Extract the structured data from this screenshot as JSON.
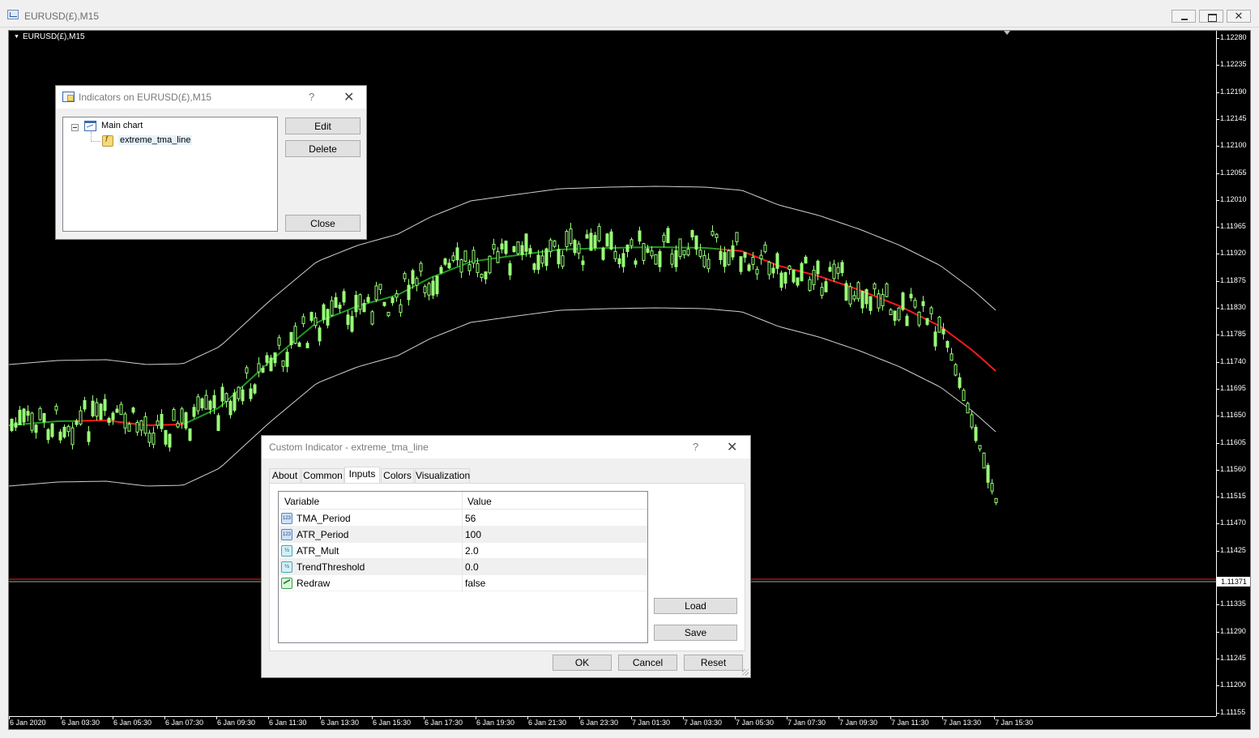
{
  "window": {
    "title": "EURUSD(£),M15"
  },
  "chart": {
    "label": "EURUSD(£),M15",
    "current_price": "1.11371",
    "price_labels": [
      "1.12280",
      "1.12235",
      "1.12190",
      "1.12145",
      "1.12100",
      "1.12055",
      "1.12010",
      "1.11965",
      "1.11920",
      "1.11875",
      "1.11830",
      "1.11785",
      "1.11740",
      "1.11695",
      "1.11650",
      "1.11605",
      "1.11560",
      "1.11515",
      "1.11470",
      "1.11425",
      "1.11335",
      "1.11290",
      "1.11245",
      "1.11200",
      "1.11155"
    ],
    "time_labels": [
      "6 Jan 2020",
      "6 Jan 03:30",
      "6 Jan 05:30",
      "6 Jan 07:30",
      "6 Jan 09:30",
      "6 Jan 11:30",
      "6 Jan 13:30",
      "6 Jan 15:30",
      "6 Jan 17:30",
      "6 Jan 19:30",
      "6 Jan 21:30",
      "6 Jan 23:30",
      "7 Jan 01:30",
      "7 Jan 03:30",
      "7 Jan 05:30",
      "7 Jan 07:30",
      "7 Jan 09:30",
      "7 Jan 11:30",
      "7 Jan 13:30",
      "7 Jan 15:30"
    ],
    "colors": {
      "background": "#000000",
      "candle": "#99ff77",
      "tma_up": "#1f9a1f",
      "tma_down": "#ff1a1a",
      "band": "#d0d0d0",
      "price_line": "#ff2020"
    }
  },
  "indicators_dialog": {
    "title": "Indicators on EURUSD(£),M15",
    "help": "?",
    "close_glyph": "✕",
    "tree_root": "Main chart",
    "tree_child": "extreme_tma_line",
    "edit_label": "Edit",
    "delete_label": "Delete",
    "close_label": "Close"
  },
  "custom_indicator_dialog": {
    "title": "Custom Indicator - extreme_tma_line",
    "help": "?",
    "close_glyph": "✕",
    "tabs": [
      "About",
      "Common",
      "Inputs",
      "Colors",
      "Visualization"
    ],
    "active_tab": "Inputs",
    "columns": {
      "variable": "Variable",
      "value": "Value"
    },
    "rows": [
      {
        "variable": "TMA_Period",
        "value": "56",
        "type_icon": "123"
      },
      {
        "variable": "ATR_Period",
        "value": "100",
        "type_icon": "123"
      },
      {
        "variable": "ATR_Mult",
        "value": "2.0",
        "type_icon": "½"
      },
      {
        "variable": "TrendThreshold",
        "value": "0.0",
        "type_icon": "½"
      },
      {
        "variable": "Redraw",
        "value": "false",
        "type_icon": ""
      }
    ],
    "load_label": "Load",
    "save_label": "Save",
    "ok_label": "OK",
    "cancel_label": "Cancel",
    "reset_label": "Reset"
  }
}
